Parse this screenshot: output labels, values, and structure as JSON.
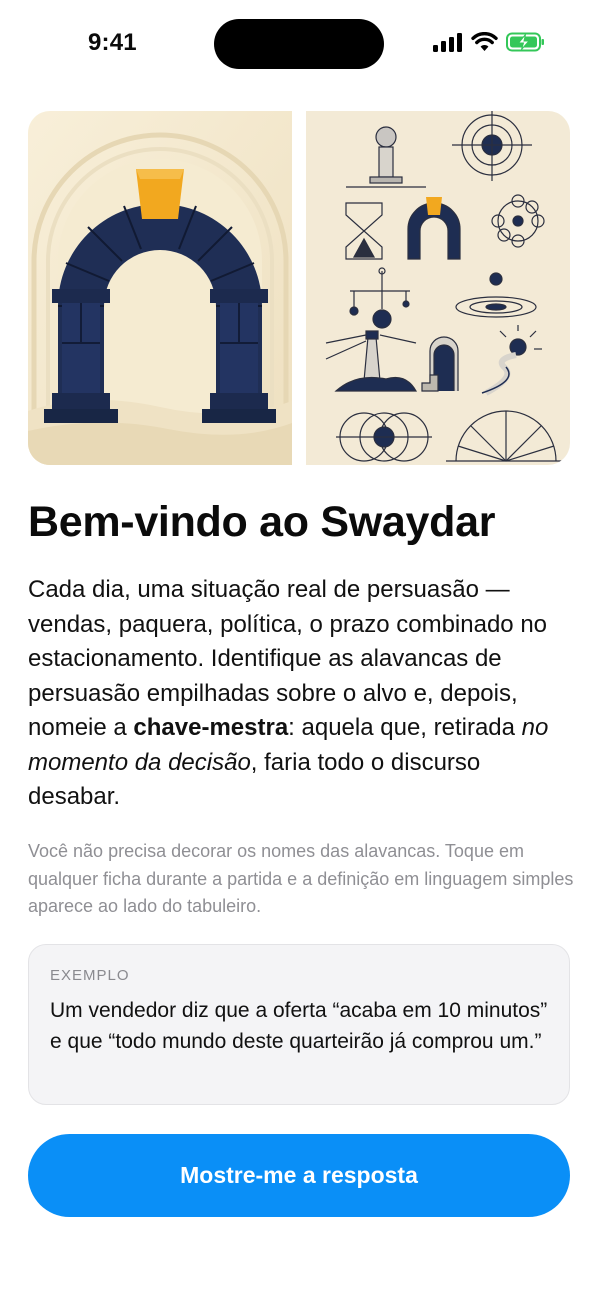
{
  "status_bar": {
    "time": "9:41",
    "icons": [
      "signal-icon",
      "wifi-icon",
      "battery-charging-icon"
    ],
    "battery_color": "#34c759"
  },
  "hero": {
    "left_image": "arch-keystone-illustration",
    "right_image": "persuasion-symbols-grid-illustration",
    "colors": {
      "navy": "#1e2d52",
      "gold": "#f2a81f",
      "cream": "#f4ead3"
    }
  },
  "onboarding": {
    "title": "Bem-vindo ao Swaydar",
    "intro": {
      "part1": "Cada dia, uma situação real de persuasão — vendas, paquera, política, o prazo combinado no estacionamento. Identifique as alavancas de persuasão empilhadas sobre o alvo e, depois, nomeie a ",
      "bold": "chave-mestra",
      "part2": ": aquela que, retirada ",
      "italic": "no momento da decisão",
      "part3": ", faria todo o discurso desabar."
    },
    "note": "Você não precisa decorar os nomes das alavancas. Toque em qualquer ficha durante a partida e a definição em linguagem simples aparece ao lado do tabuleiro.",
    "example": {
      "label": "EXEMPLO",
      "text": "Um vendedor diz que a oferta “acaba em 10 minutos” e que “todo mundo deste quarteirão já comprou um.”"
    },
    "cta_label": "Mostre-me a resposta",
    "accent_color": "#0a8ff7"
  }
}
